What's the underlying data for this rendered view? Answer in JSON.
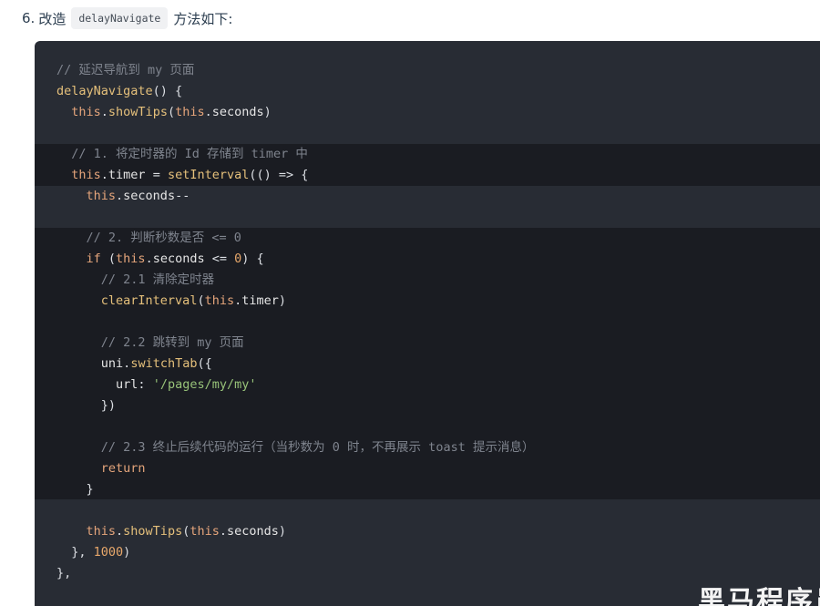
{
  "step": {
    "number": "6.",
    "prefix": "改造",
    "code": "delayNavigate",
    "suffix": "方法如下:"
  },
  "code_lines": [
    [
      [
        "c",
        "// 延迟导航到 my 页面"
      ]
    ],
    [
      [
        "f",
        "delayNavigate"
      ],
      [
        "p",
        "() {"
      ]
    ],
    [
      [
        "p",
        "  "
      ],
      [
        "k",
        "this"
      ],
      [
        "p",
        "."
      ],
      [
        "f",
        "showTips"
      ],
      [
        "p",
        "("
      ],
      [
        "k",
        "this"
      ],
      [
        "p",
        "."
      ],
      [
        "i",
        "seconds"
      ],
      [
        "p",
        ")"
      ]
    ],
    [],
    [
      [
        "p",
        "  "
      ],
      [
        "c",
        "// 1. 将定时器的 Id 存储到 timer 中"
      ]
    ],
    [
      [
        "p",
        "  "
      ],
      [
        "k",
        "this"
      ],
      [
        "p",
        "."
      ],
      [
        "i",
        "timer"
      ],
      [
        "p",
        " = "
      ],
      [
        "f",
        "setInterval"
      ],
      [
        "p",
        "(() => {"
      ]
    ],
    [
      [
        "p",
        "    "
      ],
      [
        "k",
        "this"
      ],
      [
        "p",
        "."
      ],
      [
        "i",
        "seconds"
      ],
      [
        "p",
        "--"
      ]
    ],
    [],
    [
      [
        "p",
        "    "
      ],
      [
        "c",
        "// 2. 判断秒数是否 <= 0"
      ]
    ],
    [
      [
        "p",
        "    "
      ],
      [
        "k",
        "if"
      ],
      [
        "p",
        " ("
      ],
      [
        "k",
        "this"
      ],
      [
        "p",
        "."
      ],
      [
        "i",
        "seconds"
      ],
      [
        "p",
        " <= "
      ],
      [
        "n",
        "0"
      ],
      [
        "p",
        ") {"
      ]
    ],
    [
      [
        "p",
        "      "
      ],
      [
        "c",
        "// 2.1 清除定时器"
      ]
    ],
    [
      [
        "p",
        "      "
      ],
      [
        "f",
        "clearInterval"
      ],
      [
        "p",
        "("
      ],
      [
        "k",
        "this"
      ],
      [
        "p",
        "."
      ],
      [
        "i",
        "timer"
      ],
      [
        "p",
        ")"
      ]
    ],
    [],
    [
      [
        "p",
        "      "
      ],
      [
        "c",
        "// 2.2 跳转到 my 页面"
      ]
    ],
    [
      [
        "p",
        "      "
      ],
      [
        "i",
        "uni"
      ],
      [
        "p",
        "."
      ],
      [
        "f",
        "switchTab"
      ],
      [
        "p",
        "({"
      ]
    ],
    [
      [
        "p",
        "        "
      ],
      [
        "i",
        "url"
      ],
      [
        "p",
        ": "
      ],
      [
        "s",
        "'/pages/my/my'"
      ]
    ],
    [
      [
        "p",
        "      })"
      ]
    ],
    [],
    [
      [
        "p",
        "      "
      ],
      [
        "c",
        "// 2.3 终止后续代码的运行（当秒数为 0 时，不再展示 toast 提示消息）"
      ]
    ],
    [
      [
        "p",
        "      "
      ],
      [
        "k",
        "return"
      ]
    ],
    [
      [
        "p",
        "    }"
      ]
    ],
    [],
    [
      [
        "p",
        "    "
      ],
      [
        "k",
        "this"
      ],
      [
        "p",
        "."
      ],
      [
        "f",
        "showTips"
      ],
      [
        "p",
        "("
      ],
      [
        "k",
        "this"
      ],
      [
        "p",
        "."
      ],
      [
        "i",
        "seconds"
      ],
      [
        "p",
        ")"
      ]
    ],
    [
      [
        "p",
        "  }, "
      ],
      [
        "n",
        "1000"
      ],
      [
        "p",
        ")"
      ]
    ],
    [
      [
        "p",
        "},"
      ]
    ]
  ],
  "watermark": "黑马程序员"
}
